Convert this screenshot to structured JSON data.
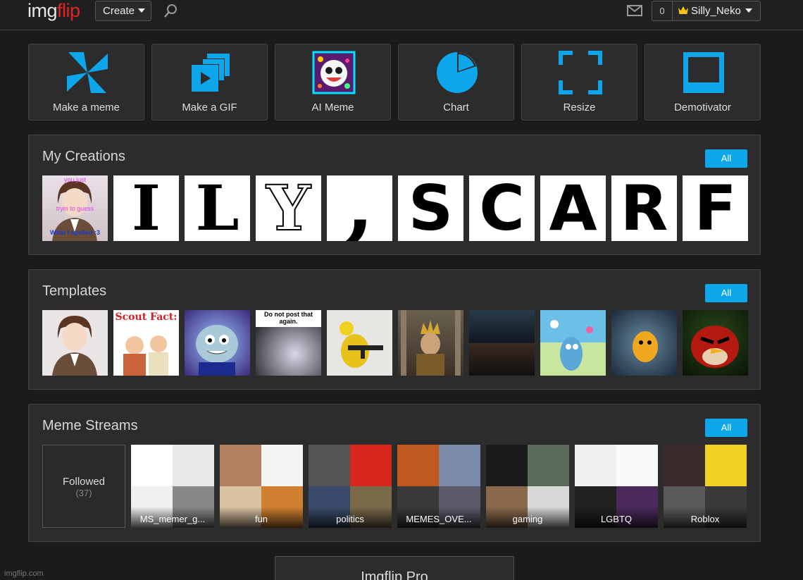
{
  "header": {
    "logo_part1": "img",
    "logo_part2": "flip",
    "create_label": "Create",
    "notification_count": "0",
    "username": "Silly_Neko"
  },
  "tools": [
    {
      "label": "Make a meme",
      "icon": "pinwheel-icon"
    },
    {
      "label": "Make a GIF",
      "icon": "gif-stack-icon"
    },
    {
      "label": "AI Meme",
      "icon": "ai-face-icon"
    },
    {
      "label": "Chart",
      "icon": "pie-chart-icon"
    },
    {
      "label": "Resize",
      "icon": "resize-corners-icon"
    },
    {
      "label": "Demotivator",
      "icon": "frame-icon"
    }
  ],
  "creations": {
    "title": "My Creations",
    "all_label": "All",
    "first_item_texts": [
      "you just",
      "tryin to guess",
      "What I spelled :3"
    ],
    "letters": [
      "I",
      "L",
      "Y",
      ",",
      "S",
      "C",
      "A",
      "R",
      "F"
    ]
  },
  "templates": {
    "title": "Templates",
    "all_label": "All",
    "items": [
      {
        "text": ""
      },
      {
        "text": "Scout Fact:"
      },
      {
        "text": ""
      },
      {
        "text": "Do not post that again."
      },
      {
        "text": ""
      },
      {
        "text": ""
      },
      {
        "text": ""
      },
      {
        "text": ""
      },
      {
        "text": ""
      },
      {
        "text": ""
      }
    ]
  },
  "streams": {
    "title": "Meme Streams",
    "all_label": "All",
    "followed_label": "Followed",
    "followed_count": "(37)",
    "items": [
      {
        "name": "MS_memer_g..."
      },
      {
        "name": "fun"
      },
      {
        "name": "politics"
      },
      {
        "name": "MEMES_OVE..."
      },
      {
        "name": "gaming"
      },
      {
        "name": "LGBTQ"
      },
      {
        "name": "Roblox"
      }
    ]
  },
  "pro_label": "Imgflip Pro",
  "footer": "imgflip.com",
  "colors": {
    "accent": "#0da6ea",
    "logo_red": "#e02424",
    "background": "#1b1b1b",
    "panel": "#2c2c2c"
  }
}
